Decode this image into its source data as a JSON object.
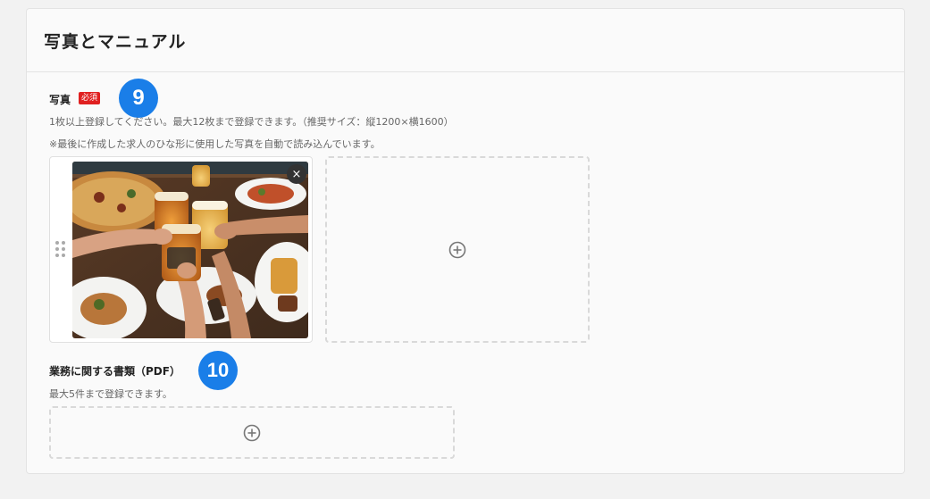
{
  "section": {
    "title": "写真とマニュアル"
  },
  "photos": {
    "label": "写真",
    "required_label": "必須",
    "step_number": "9",
    "note_count": "1枚以上登録してください。最大12枚まで登録できます。（推奨サイズ：縦1200×横1600）",
    "note_auto": "※最後に作成した求人のひな形に使用した写真を自動で読み込んでいます。",
    "remove_label": "×",
    "uploaded_image": "restaurant-toast-photo"
  },
  "documents": {
    "label": "業務に関する書類（PDF）",
    "step_number": "10",
    "note": "最大5件まで登録できます。"
  },
  "colors": {
    "accent": "#1a7ee8",
    "required": "#e02020"
  },
  "icons": {
    "add": "plus-circle-icon",
    "remove": "close-icon",
    "drag": "drag-handle-icon"
  }
}
